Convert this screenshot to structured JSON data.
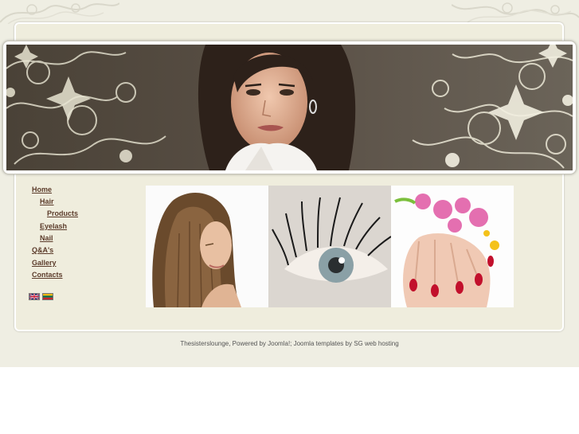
{
  "nav": {
    "items": [
      {
        "label": "Home"
      },
      {
        "label": "Hair"
      },
      {
        "label": "Products"
      },
      {
        "label": "Eyelash"
      },
      {
        "label": "Nail"
      },
      {
        "label": "Q&A's"
      },
      {
        "label": "Gallery"
      },
      {
        "label": "Contacts"
      }
    ]
  },
  "languages": [
    {
      "icon": "uk-flag-icon"
    },
    {
      "icon": "lithuania-flag-icon"
    }
  ],
  "footer": {
    "text": "Thesisterslounge, Powered by Joomla!; Joomla templates by SG web hosting"
  },
  "colors": {
    "page_background": "#efeee3",
    "content_background": "#efeddd",
    "nav_link": "#5b3b2a",
    "footer_text": "#555555"
  }
}
